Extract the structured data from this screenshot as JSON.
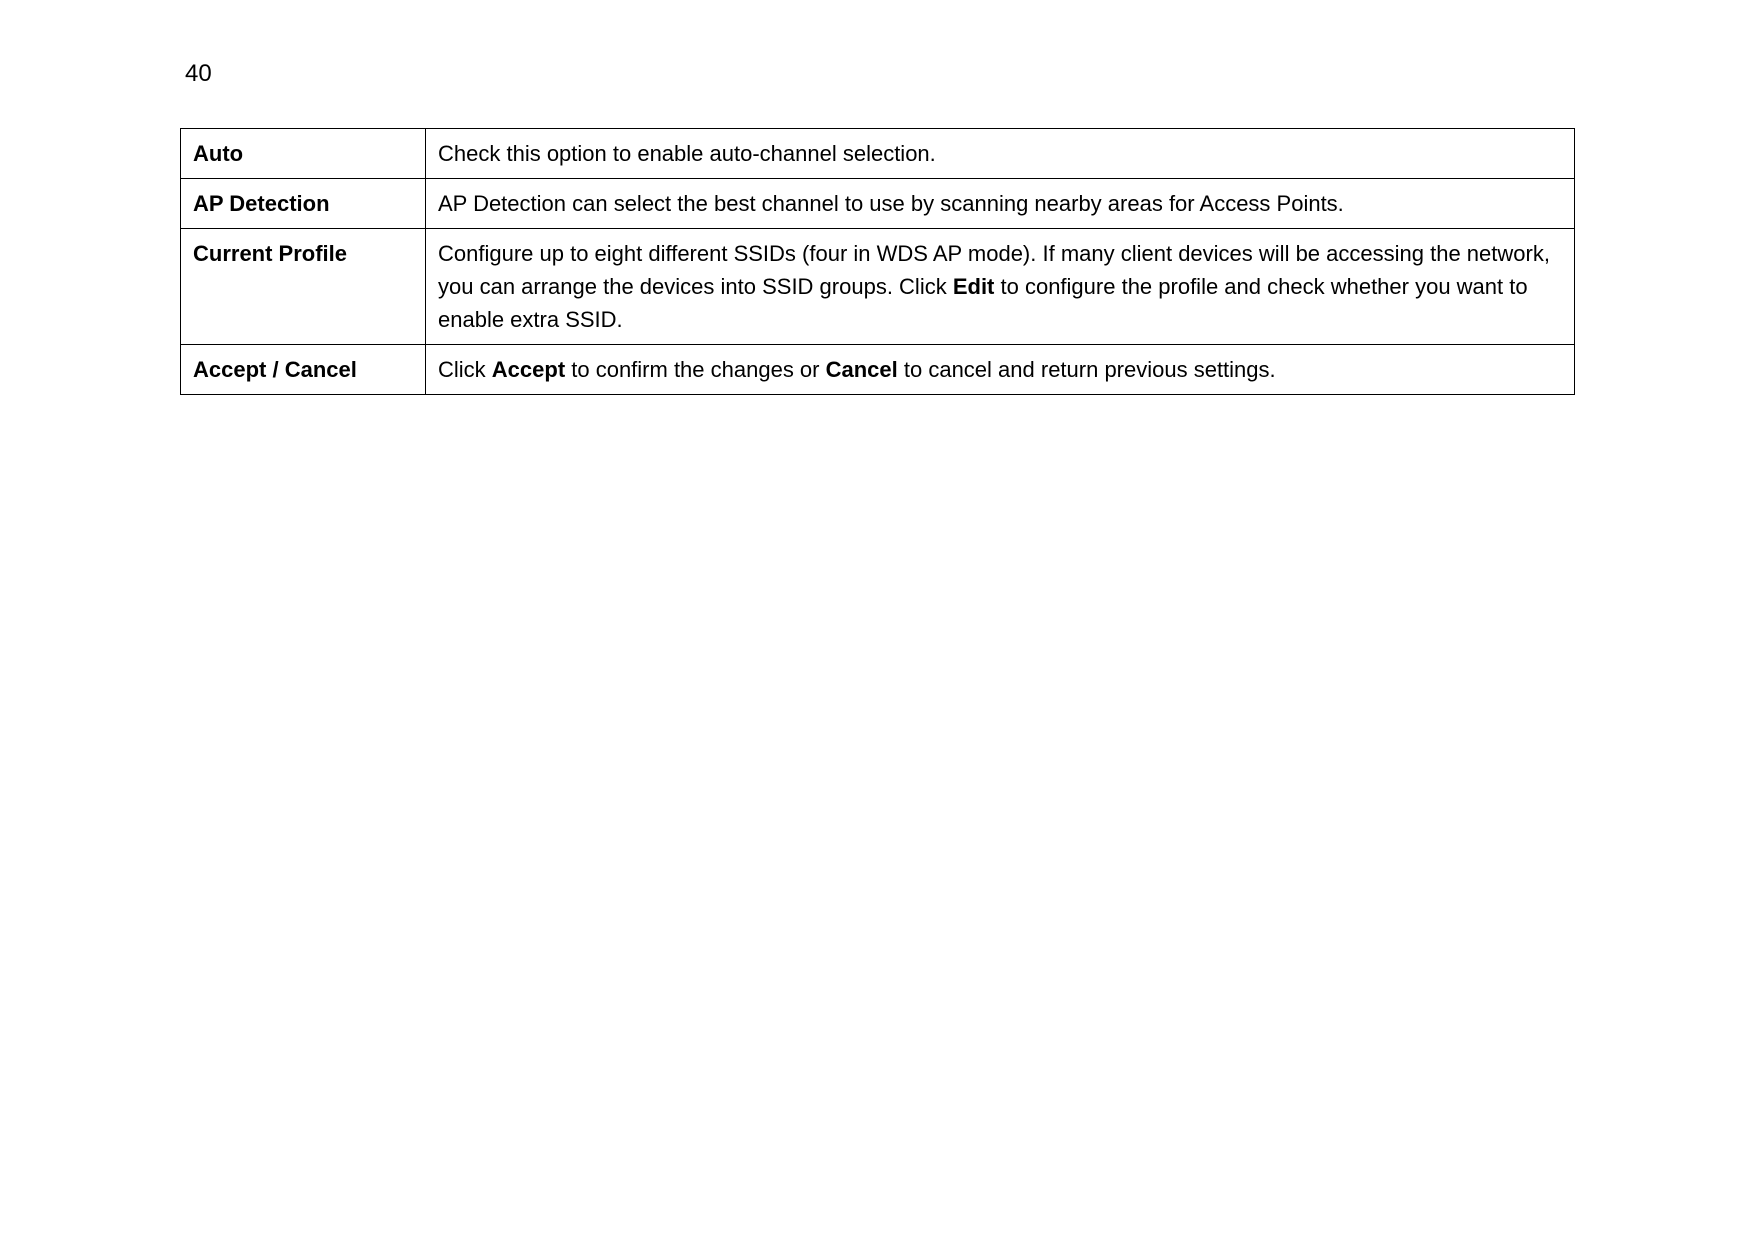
{
  "page_number": "40",
  "rows": {
    "r1": {
      "label": "Auto",
      "desc": "Check this option to enable auto-channel selection."
    },
    "r2": {
      "label": "AP Detection",
      "desc": "AP Detection can select the best channel to use by scanning nearby areas for Access Points."
    },
    "r3": {
      "label": "Current Profile",
      "desc_part1": "Configure up to eight different SSIDs (four in WDS AP mode). If many client devices will be accessing the network, you can arrange the devices into SSID groups. Click ",
      "desc_bold1": "Edit",
      "desc_part2": " to configure the profile and check whether you want to enable extra SSID."
    },
    "r4": {
      "label": "Accept / Cancel",
      "desc_part1": "Click ",
      "desc_bold1": "Accept",
      "desc_part2": " to confirm the changes or ",
      "desc_bold2": "Cancel",
      "desc_part3": " to cancel and return previous settings."
    }
  }
}
